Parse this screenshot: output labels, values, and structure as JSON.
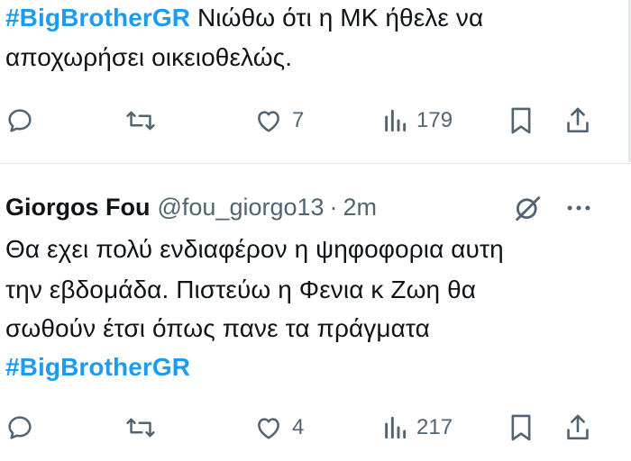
{
  "tweet1": {
    "hashtag": "#BigBrotherGR",
    "text_line1": " Νιώθω ότι η ΜΚ ήθελε να",
    "text_line2": "αποχωρήσει οικειοθελώς.",
    "actions": {
      "reply_icon": "reply-icon",
      "retweet_icon": "retweet-icon",
      "likes": "7",
      "views": "179"
    }
  },
  "tweet2": {
    "author": "Giorgos Fou",
    "handle": "@fou_giorgo13",
    "separator": "·",
    "time": "2m",
    "text_line1": "Θα εχει πολύ ενδιαφέρον η ψηφοφορια αυτη",
    "text_line2": "την εβδομάδα.  Πιστεύω η Φενια κ Ζωη θα",
    "text_line3": "σωθούν έτσι όπως πανε τα πράγματα",
    "hashtag": "#BigBrotherGR",
    "actions": {
      "likes": "4",
      "views": "217"
    }
  },
  "colors": {
    "hashtag": "#1d9bf0",
    "text": "#0f1419",
    "secondary": "#536471",
    "divider": "#e3e7ea"
  }
}
